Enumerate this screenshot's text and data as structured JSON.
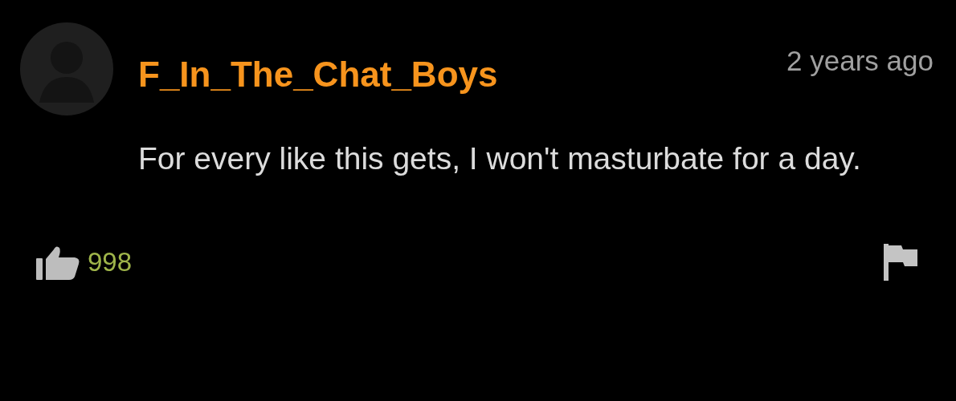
{
  "comment": {
    "author": "F_In_The_Chat_Boys",
    "time": "2 years ago",
    "text": "For every like this gets, I won't masturbate for a day.",
    "likes": "998"
  }
}
